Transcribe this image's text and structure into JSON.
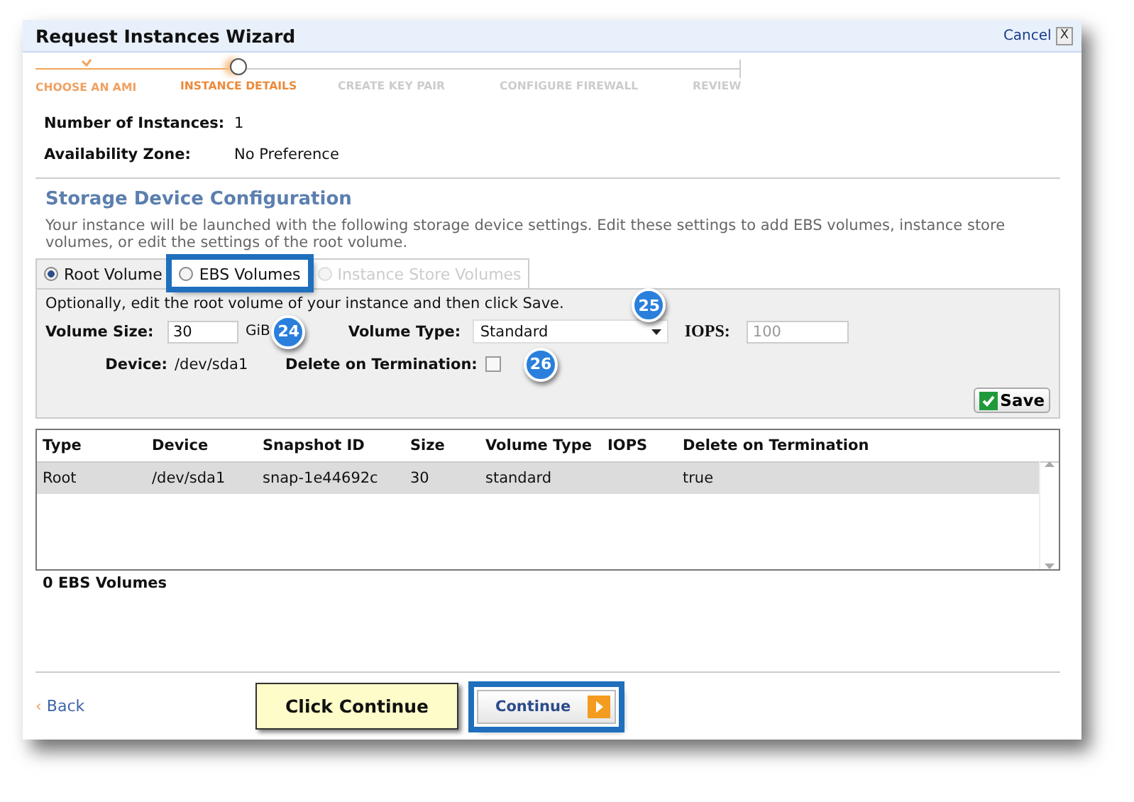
{
  "window": {
    "title": "Request Instances Wizard",
    "cancel": "Cancel",
    "close": "X"
  },
  "steps": [
    {
      "label": "CHOOSE AN AMI",
      "done": true,
      "selected": false
    },
    {
      "label": "INSTANCE DETAILS",
      "done": false,
      "selected": true
    },
    {
      "label": "CREATE KEY PAIR",
      "done": false,
      "selected": false
    },
    {
      "label": "CONFIGURE FIREWALL",
      "done": false,
      "selected": false
    },
    {
      "label": "REVIEW",
      "done": false,
      "selected": false
    }
  ],
  "summary": [
    {
      "label": "Number of Instances:",
      "value": "1"
    },
    {
      "label": "Availability Zone:",
      "value": "No Preference"
    }
  ],
  "storage": {
    "title": "Storage Device Configuration",
    "description": "Your instance will be launched with the following storage device settings. Edit these settings to add EBS volumes, instance store volumes, or edit the settings of the root volume.",
    "tabs": [
      {
        "label": "Root Volume",
        "selected": true,
        "disabled": false,
        "highlighted": false
      },
      {
        "label": "EBS Volumes",
        "selected": false,
        "disabled": false,
        "highlighted": true
      },
      {
        "label": "Instance Store Volumes",
        "selected": false,
        "disabled": true,
        "highlighted": false
      }
    ],
    "hint": "Optionally, edit the root volume of your instance and then click Save.",
    "volume_size": {
      "label": "Volume Size:",
      "value": "30",
      "unit": "GiB",
      "badge": "24"
    },
    "volume_type": {
      "label": "Volume Type:",
      "value": "Standard",
      "badge": "25"
    },
    "iops": {
      "label": "IOPS:",
      "value": "100",
      "disabled": true
    },
    "device": {
      "label": "Device:",
      "value": "/dev/sda1"
    },
    "delete_on_termination": {
      "label": "Delete on Termination:",
      "checked": false,
      "badge": "26"
    },
    "save_button": "Save"
  },
  "table": {
    "columns": [
      "Type",
      "Device",
      "Snapshot ID",
      "Size",
      "Volume Type",
      "IOPS",
      "Delete on Termination"
    ],
    "rows": [
      {
        "selected": true,
        "cells": [
          "Root",
          "/dev/sda1",
          "snap-1e44692c",
          "30",
          "standard",
          "",
          "true"
        ]
      }
    ]
  },
  "ebs_count": "0 EBS Volumes",
  "footer": {
    "back_icon": "‹",
    "back": "Back",
    "tooltip": "Click Continue",
    "continue": "Continue",
    "continue_highlighted": true
  }
}
